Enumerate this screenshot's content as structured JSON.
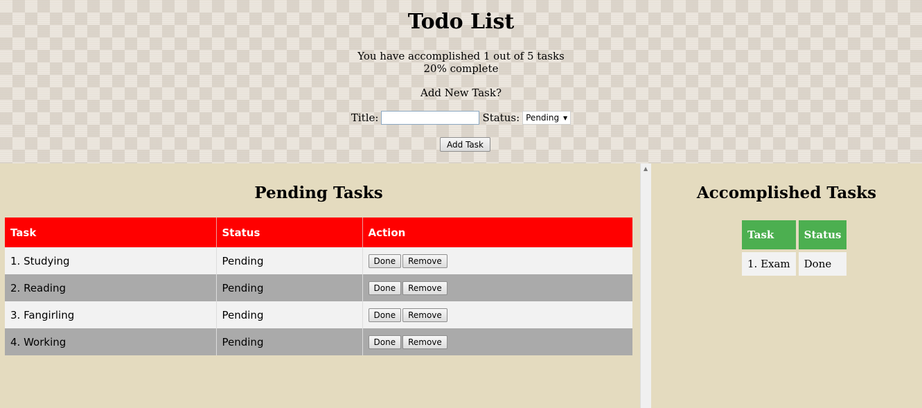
{
  "app": {
    "title": "Todo List"
  },
  "summary": {
    "progress_text": "You have accomplished 1 out of 5 tasks",
    "percent_text": "20% complete",
    "completed": 1,
    "total": 5,
    "percent": 20
  },
  "add_form": {
    "heading": "Add New Task?",
    "title_label": "Title:",
    "title_value": "",
    "status_label": "Status:",
    "status_selected": "Pending",
    "submit_label": "Add Task"
  },
  "pending": {
    "heading": "Pending Tasks",
    "columns": [
      "Task",
      "Status",
      "Action"
    ],
    "done_label": "Done",
    "remove_label": "Remove",
    "rows": [
      {
        "task": "1. Studying",
        "status": "Pending"
      },
      {
        "task": "2. Reading",
        "status": "Pending"
      },
      {
        "task": "3. Fangirling",
        "status": "Pending"
      },
      {
        "task": "4. Working",
        "status": "Pending"
      }
    ]
  },
  "accomplished": {
    "heading": "Accomplished Tasks",
    "columns": [
      "Task",
      "Status"
    ],
    "rows": [
      {
        "task": "1. Exam",
        "status": "Done"
      }
    ]
  },
  "colors": {
    "pending_header": "#ff0000",
    "accomplished_header": "#4caf50",
    "panel_background": "#e4dbbf",
    "row_light": "#f2f2f2",
    "row_dark": "#aaaaaa"
  },
  "icons": {
    "select_arrow": "chevron-down-icon",
    "scroll_up": "scroll-up-arrow-icon"
  }
}
